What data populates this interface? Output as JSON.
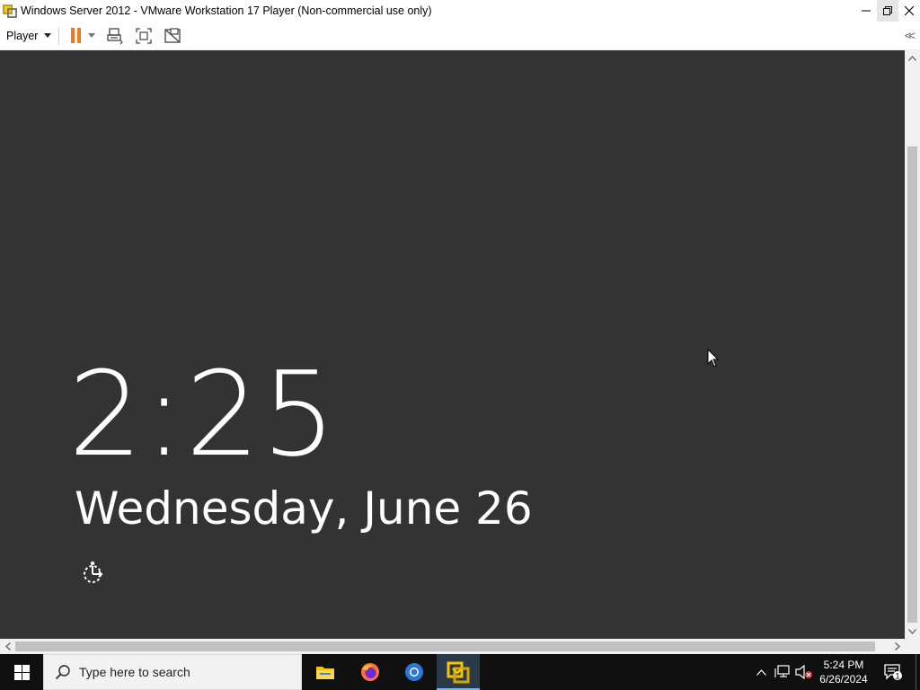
{
  "window": {
    "title": "Windows Server 2012 - VMware Workstation 17 Player (Non-commercial use only)",
    "minimize": "–",
    "restore": "❐",
    "close": "✕"
  },
  "toolbar": {
    "player_menu": "Player",
    "collapse": "<<"
  },
  "lockscreen": {
    "time": "2:25",
    "date": "Wednesday, June 26"
  },
  "taskbar": {
    "search_placeholder": "Type here to search",
    "clock_time": "5:24 PM",
    "clock_date": "6/26/2024",
    "notification_count": "1"
  },
  "icons": {
    "app": "vmware-icon",
    "pause": "pause-icon",
    "send_ctrl_alt_del": "ctrl-alt-del-icon",
    "fullscreen": "fullscreen-icon",
    "unity": "unity-icon",
    "ease_of_access": "ease-of-access-icon",
    "start": "windows-icon",
    "file_explorer": "folder-icon",
    "firefox": "firefox-icon",
    "chrome": "chrome-icon",
    "vmware_taskbar": "vmware-icon"
  },
  "colors": {
    "vm_background": "#333333",
    "pause_accent": "#f07a22",
    "taskbar": "#101010"
  }
}
